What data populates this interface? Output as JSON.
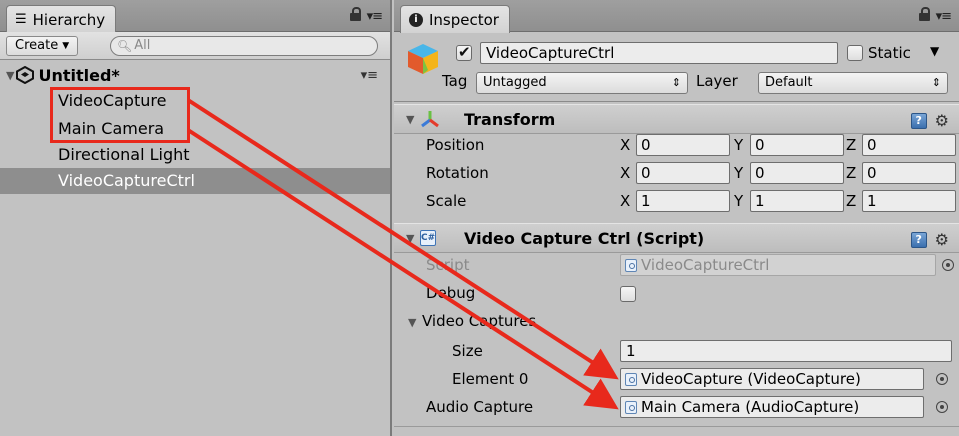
{
  "hierarchy": {
    "tab_label": "Hierarchy",
    "tab_icon": "list-icon",
    "create_label": "Create",
    "search_placeholder": "All",
    "scene_name": "Untitled*",
    "items": [
      {
        "label": "VideoCapture"
      },
      {
        "label": "Main Camera"
      },
      {
        "label": "Directional Light"
      },
      {
        "label": "VideoCaptureCtrl",
        "selected": true
      }
    ]
  },
  "inspector": {
    "tab_label": "Inspector",
    "tab_icon": "info-icon",
    "gameobject": {
      "active": true,
      "name": "VideoCaptureCtrl",
      "static_label": "Static",
      "static": false,
      "tag_label": "Tag",
      "tag_value": "Untagged",
      "layer_label": "Layer",
      "layer_value": "Default"
    },
    "transform": {
      "title": "Transform",
      "rows": [
        {
          "label": "Position",
          "x": "0",
          "y": "0",
          "z": "0"
        },
        {
          "label": "Rotation",
          "x": "0",
          "y": "0",
          "z": "0"
        },
        {
          "label": "Scale",
          "x": "1",
          "y": "1",
          "z": "1"
        }
      ],
      "axis_labels": {
        "x": "X",
        "y": "Y",
        "z": "Z"
      }
    },
    "script_component": {
      "title": "Video Capture Ctrl (Script)",
      "script_label": "Script",
      "script_value": "VideoCaptureCtrl",
      "debug_label": "Debug",
      "debug": false,
      "video_captures_label": "Video Captures",
      "size_label": "Size",
      "size_value": "1",
      "element0_label": "Element 0",
      "element0_value": "VideoCapture (VideoCapture)",
      "audio_capture_label": "Audio Capture",
      "audio_capture_value": "Main Camera (AudioCapture)"
    }
  },
  "annotation": {
    "color": "#e8291c"
  }
}
